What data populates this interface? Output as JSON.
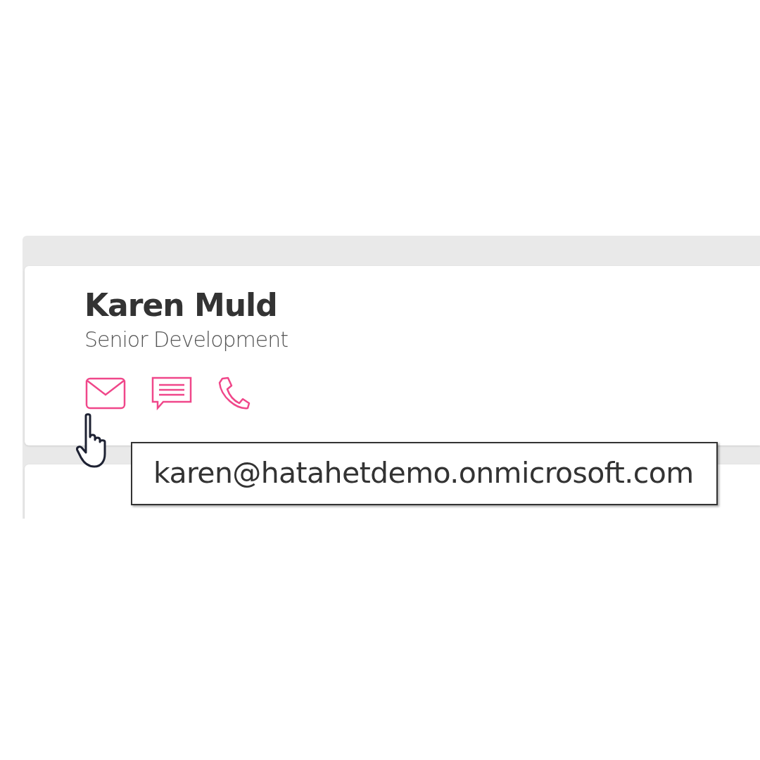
{
  "contacts": [
    {
      "name": "Karen Muld",
      "title": "Senior Development",
      "actions": [
        {
          "kind": "mail"
        },
        {
          "kind": "chat"
        },
        {
          "kind": "phone"
        }
      ]
    },
    {
      "kind": "card"
    }
  ],
  "tooltip": {
    "text": "karen@hatahetdemo.onmicrosoft.com"
  }
}
